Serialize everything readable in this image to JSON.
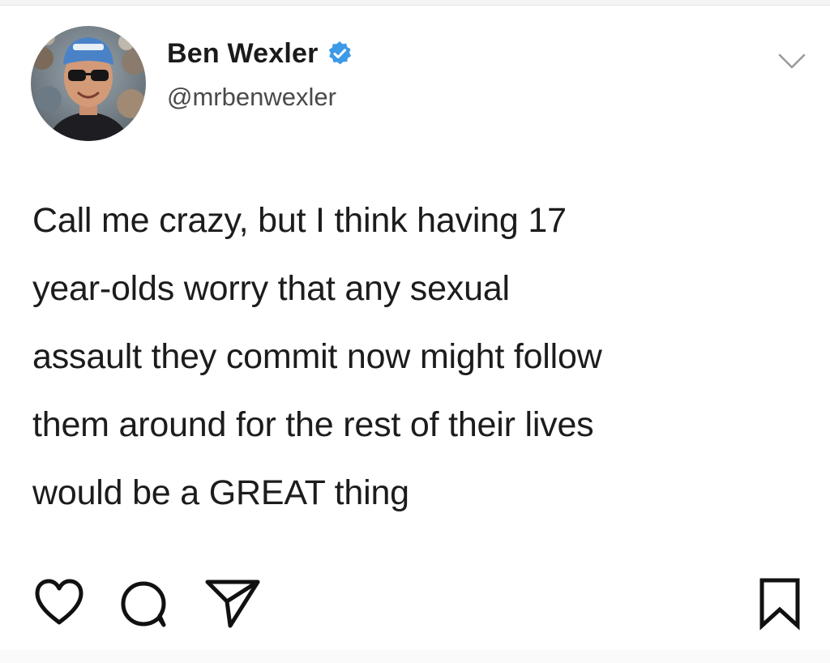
{
  "tweet": {
    "author": {
      "display_name": "Ben Wexler",
      "handle": "@mrbenwexler",
      "verified": true,
      "avatar_icon": "user-photo-avatar"
    },
    "text": "Call me crazy, but I think having 17\nyear-olds worry that any sexual\nassault they commit now might follow\nthem around for the rest of their lives\nwould be a GREAT thing",
    "menu_icon": "chevron-down-icon"
  },
  "actions": {
    "like_icon": "heart-icon",
    "comment_icon": "comment-icon",
    "share_icon": "send-icon",
    "bookmark_icon": "bookmark-icon"
  },
  "colors": {
    "verified_badge": "#3c9ae8",
    "text": "#1c1c1c",
    "handle": "#4a4a4a",
    "icon_stroke": "#111111"
  }
}
